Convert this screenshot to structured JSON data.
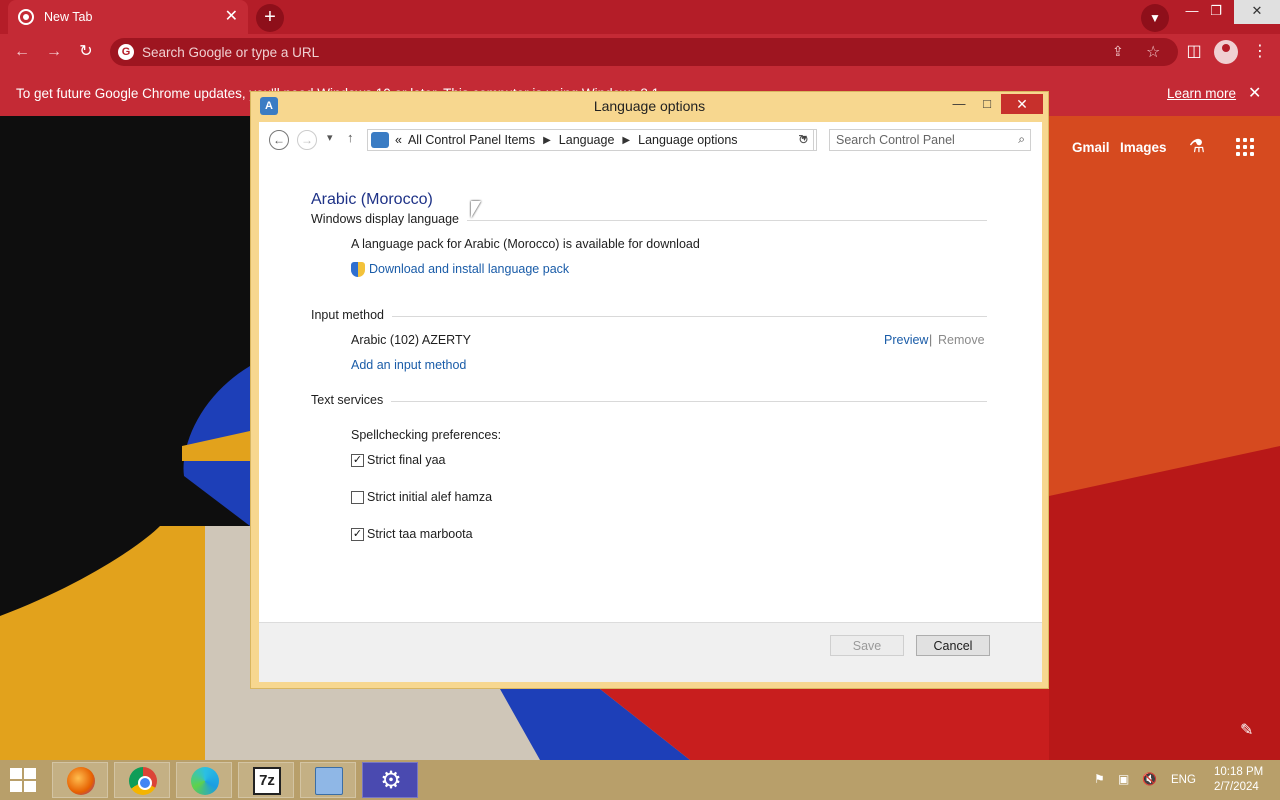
{
  "chrome": {
    "tab_title": "New Tab",
    "tab_close": "✕",
    "new_tab": "+",
    "omnibox_placeholder": "Search Google or type a URL",
    "infobar_message": "To get future Google Chrome updates, you'll need Windows 10 or later. This computer is using Windows 8.1.",
    "infobar_link": "Learn more",
    "page_links": [
      "Gmail",
      "Images"
    ]
  },
  "dialog": {
    "title": "Language options",
    "breadcrumb": [
      "All Control Panel Items",
      "Language",
      "Language options"
    ],
    "breadcrumb_prefix": "«",
    "search_placeholder": "Search Control Panel",
    "language": "Arabic (Morocco)",
    "display_section": "Windows display language",
    "pack_message": "A language pack for Arabic (Morocco) is available for download",
    "download_link": "Download and install language pack",
    "input_section": "Input method",
    "input_method": "Arabic (102) AZERTY",
    "preview_link": "Preview",
    "separator": "|",
    "remove_link": "Remove",
    "add_input_link": "Add an input method",
    "text_services_section": "Text services",
    "spell_label": "Spellchecking preferences:",
    "checkboxes": [
      {
        "label": "Strict final yaa",
        "checked": true
      },
      {
        "label": "Strict initial alef hamza",
        "checked": false
      },
      {
        "label": "Strict taa marboota",
        "checked": true
      }
    ],
    "save_label": "Save",
    "cancel_label": "Cancel"
  },
  "taskbar": {
    "apps": [
      "firefox-icon",
      "chrome-icon",
      "edge-icon",
      "7zip-icon",
      "control-panel-icon",
      "settings-icon"
    ],
    "zip_glyph": "7z",
    "language": "ENG",
    "time": "10:18 PM",
    "date": "2/7/2024"
  },
  "colors": {
    "chrome_frame": "#b41d28",
    "dialog_frame": "#f7d78f",
    "link": "#1a5ca8",
    "heading": "#1e3287"
  }
}
